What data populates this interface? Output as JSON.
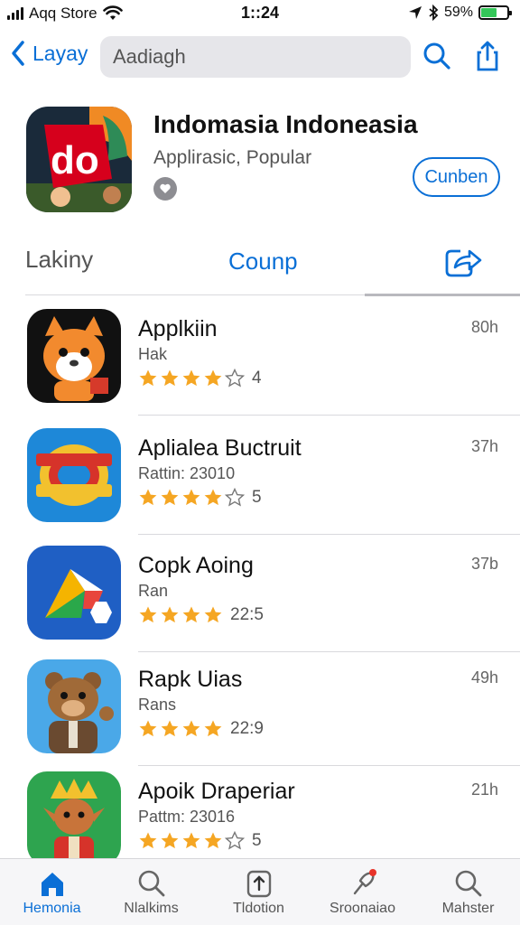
{
  "status_bar": {
    "carrier": "Aqq Store",
    "time": "1::24",
    "battery_percent": "59%",
    "battery_level": 0.59
  },
  "nav": {
    "back_label": "Layay",
    "search_value": "Aadiagh",
    "icons": [
      "chevron-left-icon",
      "search-icon",
      "share-icon"
    ]
  },
  "header": {
    "app_title": "Indomasia Indoneasia",
    "app_subtitle": "Applirasic, Popular",
    "app_icon_text": "do",
    "badge_icon": "heart-icon",
    "get_button": "Cunben"
  },
  "tabs": {
    "left": "Lakiny",
    "middle": "Counp",
    "right_icon": "share-arrow-icon"
  },
  "apps": [
    {
      "name": "Applkiin",
      "sub": "Hak",
      "stars": 4,
      "empty_star": true,
      "rating": "4",
      "time": "80h",
      "icon": "fox-icon"
    },
    {
      "name": "Aplialea Buctruit",
      "sub": "Rattin: 23010",
      "stars": 4,
      "empty_star": true,
      "rating": "5",
      "time": "37h",
      "icon": "logo-badge-icon"
    },
    {
      "name": "Copk Aoing",
      "sub": "Ran",
      "stars": 4,
      "empty_star": false,
      "rating": "22:5",
      "time": "37b",
      "icon": "play-shape-icon"
    },
    {
      "name": "Rapk Uias",
      "sub": "Rans",
      "stars": 4,
      "empty_star": false,
      "rating": "22:9",
      "time": "49h",
      "icon": "bear-icon"
    },
    {
      "name": "Apoik Draperiar",
      "sub": "Pattm: 23016",
      "stars": 4,
      "empty_star": true,
      "rating": "5",
      "time": "21h",
      "icon": "elf-icon"
    }
  ],
  "tabbar": [
    {
      "label": "Hemonia",
      "icon": "home-icon",
      "active": true
    },
    {
      "label": "Nlalkims",
      "icon": "search-icon",
      "active": false
    },
    {
      "label": "Tldotion",
      "icon": "upload-icon",
      "active": false
    },
    {
      "label": "Sroonaiao",
      "icon": "pin-icon",
      "active": false
    },
    {
      "label": "Mahster",
      "icon": "search-icon",
      "active": false
    }
  ],
  "colors": {
    "accent": "#0a6fd6",
    "star": "#f5a623",
    "battery": "#34c759"
  }
}
